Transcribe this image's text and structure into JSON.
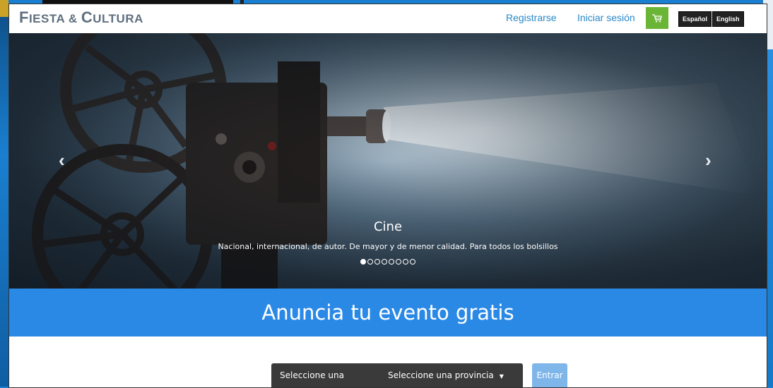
{
  "header": {
    "logo_first_letter": "F",
    "logo_first_rest": "IESTA",
    "logo_amp": "&",
    "logo_second_letter": "C",
    "logo_second_rest": "ULTURA",
    "register_label": "Registrarse",
    "login_label": "Iniciar sesión",
    "cart_icon": "shopping-cart-icon",
    "languages": [
      "Español",
      "English"
    ]
  },
  "hero": {
    "title": "Cine",
    "subtitle": "Nacional, internacional, de autor. De mayor y de menor calidad. Para todos los bolsillos",
    "prev_arrow": "‹",
    "next_arrow": "›",
    "slide_count": 8,
    "active_slide": 1
  },
  "banner": {
    "text": "Anuncia tu evento gratis"
  },
  "search": {
    "category_label": "Seleccione una categoría",
    "province_label": "Seleccione una provincia",
    "submit_label": "Entrar"
  },
  "colors": {
    "brand_blue": "#2b89e6",
    "link_blue": "#2a88c8",
    "cart_green": "#6bb536",
    "dark_select": "#3a3a3a"
  }
}
